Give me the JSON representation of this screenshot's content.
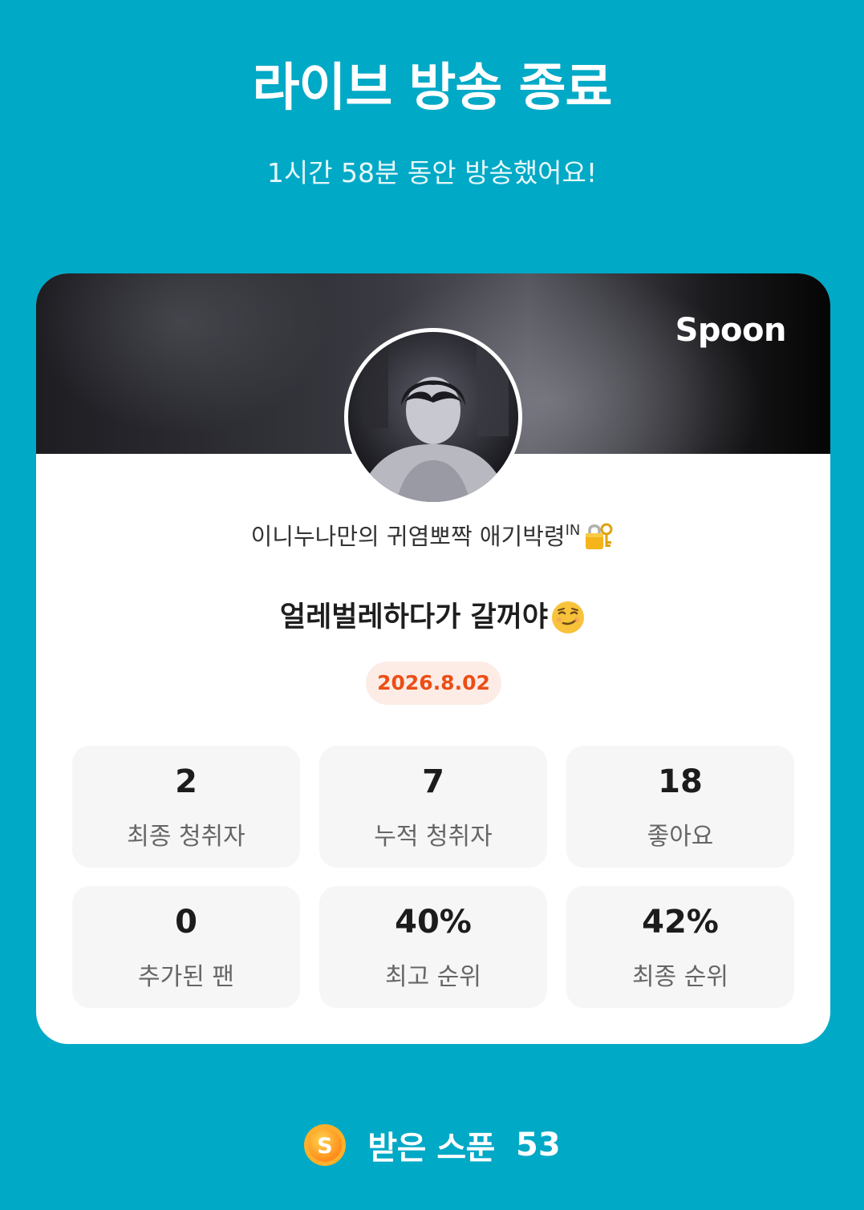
{
  "header": {
    "title": "라이브 방송 종료",
    "subtitle": "1시간 58분 동안 방송했어요!"
  },
  "card": {
    "brand": "Spoon",
    "nickname": "이니누나만의 귀염뽀짝 애기박령",
    "nickname_suffix": "IN",
    "nickname_icon": "lock-with-key-icon",
    "live_title": "얼레벌레하다가 갈꺼야",
    "live_title_icon": "smirking-face-icon",
    "date": "2026.8.02"
  },
  "stats": [
    {
      "value": "2",
      "label": "최종 청취자"
    },
    {
      "value": "7",
      "label": "누적 청취자"
    },
    {
      "value": "18",
      "label": "좋아요"
    },
    {
      "value": "0",
      "label": "추가된 팬"
    },
    {
      "value": "40%",
      "label": "최고 순위"
    },
    {
      "value": "42%",
      "label": "최종 순위"
    }
  ],
  "footer": {
    "icon": "spoon-coin-icon",
    "coin_letter": "S",
    "label": "받은 스푼",
    "count": "53"
  },
  "colors": {
    "background": "#00a9c6",
    "date_text": "#ec4e16",
    "date_bg": "#fdece6",
    "stat_bg": "#f6f6f6"
  }
}
